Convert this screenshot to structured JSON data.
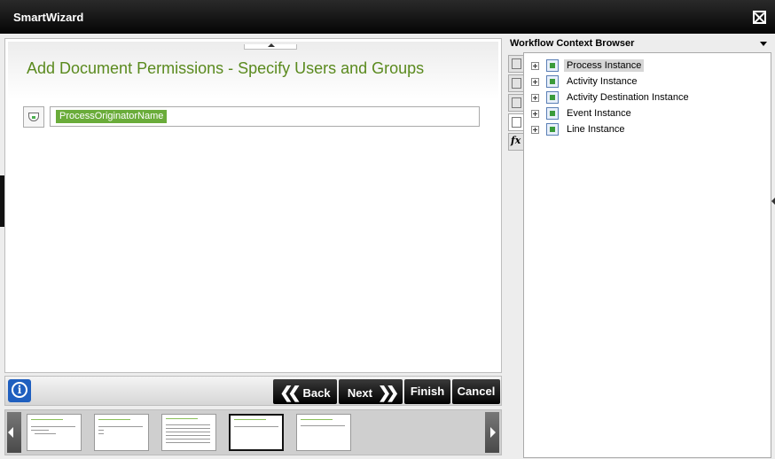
{
  "window": {
    "title": "SmartWizard"
  },
  "content": {
    "heading": "Add Document Permissions - Specify Users and Groups",
    "field_token": "ProcessOriginatorName"
  },
  "toolbar": {
    "back_label": "Back",
    "next_label": "Next",
    "finish_label": "Finish",
    "cancel_label": "Cancel",
    "info_glyph": "i"
  },
  "context_browser": {
    "title": "Workflow Context Browser",
    "items": [
      {
        "label": "Process Instance",
        "selected": true
      },
      {
        "label": "Activity Instance",
        "selected": false
      },
      {
        "label": "Activity Destination Instance",
        "selected": false
      },
      {
        "label": "Event Instance",
        "selected": false
      },
      {
        "label": "Line Instance",
        "selected": false
      }
    ]
  },
  "icons": {
    "close": "close-icon",
    "info": "info-icon",
    "back": "chevron-double-left-icon",
    "next": "chevron-double-right-icon",
    "dropdown": "chevron-down-icon",
    "function": "fx-icon"
  },
  "colors": {
    "accent_green": "#5a8a1e",
    "token_green": "#6aac3a",
    "info_blue": "#1f5fbf",
    "titlebar": "#050505"
  }
}
